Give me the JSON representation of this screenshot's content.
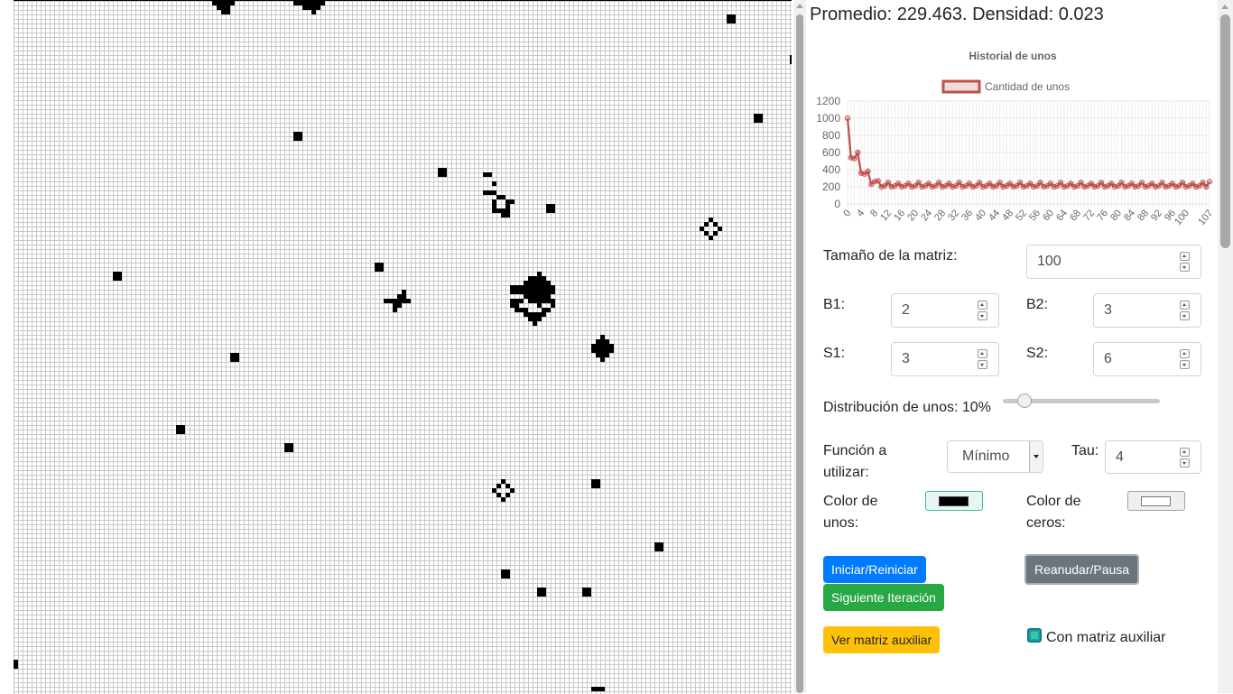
{
  "stats": {
    "text": "Promedio: 229.463. Densidad: 0.023"
  },
  "chart_data": {
    "type": "line",
    "title": "Historial de unos",
    "series": [
      {
        "name": "Cantidad de unos",
        "color": "#c0504d",
        "x": [
          0,
          1,
          2,
          3,
          4,
          5,
          6,
          7,
          8,
          9,
          10,
          11,
          12,
          13,
          14,
          15,
          16,
          17,
          18,
          19,
          20,
          21,
          22,
          23,
          24,
          25,
          26,
          27,
          28,
          29,
          30,
          31,
          32,
          33,
          34,
          35,
          36,
          37,
          38,
          39,
          40,
          41,
          42,
          43,
          44,
          45,
          46,
          47,
          48,
          49,
          50,
          51,
          52,
          53,
          54,
          55,
          56,
          57,
          58,
          59,
          60,
          61,
          62,
          63,
          64,
          65,
          66,
          67,
          68,
          69,
          70,
          71,
          72,
          73,
          74,
          75,
          76,
          77,
          78,
          79,
          80,
          81,
          82,
          83,
          84,
          85,
          86,
          87,
          88,
          89,
          90,
          91,
          92,
          93,
          94,
          95,
          96,
          97,
          98,
          99,
          100,
          101,
          102,
          103,
          104,
          105,
          106,
          107
        ],
        "values": [
          1000,
          540,
          530,
          600,
          360,
          350,
          380,
          230,
          260,
          270,
          200,
          210,
          250,
          200,
          210,
          240,
          200,
          210,
          240,
          200,
          210,
          250,
          200,
          210,
          240,
          200,
          210,
          250,
          200,
          210,
          240,
          200,
          210,
          250,
          200,
          210,
          240,
          200,
          210,
          250,
          200,
          210,
          240,
          200,
          210,
          250,
          200,
          210,
          240,
          200,
          210,
          250,
          200,
          210,
          240,
          200,
          210,
          250,
          200,
          210,
          240,
          200,
          210,
          250,
          200,
          210,
          240,
          200,
          210,
          250,
          200,
          210,
          240,
          200,
          210,
          250,
          200,
          210,
          240,
          200,
          210,
          250,
          200,
          210,
          240,
          200,
          210,
          250,
          200,
          210,
          240,
          200,
          210,
          250,
          200,
          210,
          240,
          200,
          210,
          250,
          200,
          210,
          240,
          200,
          210,
          250,
          200,
          260
        ]
      }
    ],
    "x_ticks": [
      "0",
      "4",
      "8",
      "12",
      "16",
      "20",
      "24",
      "28",
      "32",
      "36",
      "40",
      "44",
      "48",
      "52",
      "56",
      "60",
      "64",
      "68",
      "72",
      "76",
      "80",
      "84",
      "88",
      "92",
      "96",
      "100",
      "107"
    ],
    "y_ticks": [
      "0",
      "200",
      "400",
      "600",
      "800",
      "1000",
      "1200"
    ],
    "ylim": [
      0,
      1200
    ],
    "xlim": [
      0,
      107
    ],
    "grid": true,
    "legend": "top"
  },
  "controls": {
    "size_label": "Tamaño de la matriz:",
    "size_value": "100",
    "b1_label": "B1:",
    "b1_value": "2",
    "b2_label": "B2:",
    "b2_value": "3",
    "s1_label": "S1:",
    "s1_value": "3",
    "s2_label": "S2:",
    "s2_value": "6",
    "dist_label": "Distribución de unos: 10%",
    "dist_value": 10,
    "func_label_1": "Función a",
    "func_label_2": "utilizar:",
    "func_value": "Mínimo",
    "tau_label": "Tau:",
    "tau_value": "4",
    "ones_color_label_1": "Color de",
    "ones_color_label_2": "unos:",
    "ones_color": "#000000",
    "zeros_color_label_1": "Color de",
    "zeros_color_label_2": "ceros:",
    "zeros_color": "#ffffff"
  },
  "buttons": {
    "start": "Iniciar/Reiniciar",
    "pause": "Reanudar/Pausa",
    "next": "Siguiente Iteración",
    "aux": "Ver matriz auxiliar",
    "checkbox_label": "Con matriz auxiliar",
    "checkbox_checked": true
  },
  "colors": {
    "primary": "#007bff",
    "success": "#28a745",
    "secondary": "#6c757d",
    "warning": "#ffc107",
    "line": "#c0504d"
  },
  "grid": {
    "live_cells": [
      [
        44,
        0
      ],
      [
        45,
        0
      ],
      [
        46,
        0
      ],
      [
        47,
        0
      ],
      [
        48,
        0
      ],
      [
        45,
        1
      ],
      [
        46,
        1
      ],
      [
        47,
        1
      ],
      [
        46,
        2
      ],
      [
        47,
        2
      ],
      [
        62,
        0
      ],
      [
        63,
        0
      ],
      [
        64,
        0
      ],
      [
        65,
        0
      ],
      [
        66,
        0
      ],
      [
        67,
        0
      ],
      [
        68,
        0
      ],
      [
        64,
        1
      ],
      [
        65,
        1
      ],
      [
        66,
        1
      ],
      [
        67,
        1
      ],
      [
        66,
        2
      ],
      [
        158,
        3
      ],
      [
        159,
        3
      ],
      [
        158,
        4
      ],
      [
        159,
        4
      ],
      [
        172,
        12
      ],
      [
        172,
        13
      ],
      [
        173,
        13
      ],
      [
        164,
        25
      ],
      [
        165,
        25
      ],
      [
        164,
        26
      ],
      [
        165,
        26
      ],
      [
        62,
        29
      ],
      [
        63,
        29
      ],
      [
        62,
        30
      ],
      [
        63,
        30
      ],
      [
        94,
        37
      ],
      [
        95,
        37
      ],
      [
        94,
        38
      ],
      [
        95,
        38
      ],
      [
        104,
        38
      ],
      [
        105,
        38
      ],
      [
        106,
        40
      ],
      [
        104,
        42
      ],
      [
        105,
        42
      ],
      [
        106,
        42
      ],
      [
        107,
        43
      ],
      [
        108,
        43
      ],
      [
        106,
        44
      ],
      [
        109,
        44
      ],
      [
        110,
        44
      ],
      [
        106,
        45
      ],
      [
        109,
        45
      ],
      [
        106,
        46
      ],
      [
        107,
        46
      ],
      [
        108,
        46
      ],
      [
        109,
        46
      ],
      [
        108,
        47
      ],
      [
        109,
        47
      ],
      [
        118,
        45
      ],
      [
        119,
        45
      ],
      [
        118,
        46
      ],
      [
        119,
        46
      ],
      [
        154,
        48
      ],
      [
        153,
        49
      ],
      [
        155,
        49
      ],
      [
        152,
        50
      ],
      [
        156,
        50
      ],
      [
        153,
        51
      ],
      [
        155,
        51
      ],
      [
        154,
        52
      ],
      [
        80,
        58
      ],
      [
        81,
        58
      ],
      [
        80,
        59
      ],
      [
        81,
        59
      ],
      [
        22,
        60
      ],
      [
        23,
        60
      ],
      [
        22,
        61
      ],
      [
        23,
        61
      ],
      [
        86,
        64
      ],
      [
        85,
        65
      ],
      [
        86,
        65
      ],
      [
        82,
        66
      ],
      [
        83,
        66
      ],
      [
        84,
        66
      ],
      [
        85,
        66
      ],
      [
        86,
        66
      ],
      [
        87,
        66
      ],
      [
        84,
        67
      ],
      [
        85,
        67
      ],
      [
        84,
        68
      ],
      [
        116,
        60
      ],
      [
        114,
        61
      ],
      [
        115,
        61
      ],
      [
        116,
        61
      ],
      [
        117,
        61
      ],
      [
        113,
        62
      ],
      [
        114,
        62
      ],
      [
        115,
        62
      ],
      [
        116,
        62
      ],
      [
        117,
        62
      ],
      [
        118,
        62
      ],
      [
        110,
        63
      ],
      [
        111,
        63
      ],
      [
        112,
        63
      ],
      [
        113,
        63
      ],
      [
        114,
        63
      ],
      [
        115,
        63
      ],
      [
        116,
        63
      ],
      [
        117,
        63
      ],
      [
        118,
        63
      ],
      [
        119,
        63
      ],
      [
        110,
        64
      ],
      [
        111,
        64
      ],
      [
        112,
        64
      ],
      [
        113,
        64
      ],
      [
        114,
        64
      ],
      [
        115,
        64
      ],
      [
        116,
        64
      ],
      [
        117,
        64
      ],
      [
        118,
        64
      ],
      [
        119,
        64
      ],
      [
        113,
        65
      ],
      [
        114,
        65
      ],
      [
        115,
        65
      ],
      [
        116,
        65
      ],
      [
        117,
        65
      ],
      [
        118,
        65
      ],
      [
        114,
        66
      ],
      [
        115,
        66
      ],
      [
        116,
        66
      ],
      [
        117,
        66
      ],
      [
        116,
        67
      ],
      [
        110,
        66
      ],
      [
        111,
        66
      ],
      [
        112,
        66
      ],
      [
        118,
        66
      ],
      [
        119,
        66
      ],
      [
        110,
        67
      ],
      [
        111,
        67
      ],
      [
        119,
        67
      ],
      [
        111,
        68
      ],
      [
        112,
        68
      ],
      [
        113,
        68
      ],
      [
        117,
        68
      ],
      [
        118,
        68
      ],
      [
        113,
        69
      ],
      [
        114,
        69
      ],
      [
        115,
        69
      ],
      [
        116,
        69
      ],
      [
        117,
        69
      ],
      [
        114,
        70
      ],
      [
        115,
        70
      ],
      [
        116,
        70
      ],
      [
        115,
        71
      ],
      [
        130,
        74
      ],
      [
        129,
        75
      ],
      [
        130,
        75
      ],
      [
        131,
        75
      ],
      [
        128,
        76
      ],
      [
        129,
        76
      ],
      [
        130,
        76
      ],
      [
        131,
        76
      ],
      [
        132,
        76
      ],
      [
        128,
        77
      ],
      [
        129,
        77
      ],
      [
        130,
        77
      ],
      [
        131,
        77
      ],
      [
        132,
        77
      ],
      [
        129,
        78
      ],
      [
        130,
        78
      ],
      [
        131,
        78
      ],
      [
        130,
        79
      ],
      [
        48,
        78
      ],
      [
        49,
        78
      ],
      [
        48,
        79
      ],
      [
        49,
        79
      ],
      [
        36,
        94
      ],
      [
        37,
        94
      ],
      [
        36,
        95
      ],
      [
        37,
        95
      ],
      [
        60,
        98
      ],
      [
        61,
        98
      ],
      [
        60,
        99
      ],
      [
        61,
        99
      ],
      [
        108,
        106
      ],
      [
        107,
        107
      ],
      [
        109,
        107
      ],
      [
        106,
        108
      ],
      [
        110,
        108
      ],
      [
        107,
        109
      ],
      [
        109,
        109
      ],
      [
        108,
        110
      ],
      [
        128,
        106
      ],
      [
        129,
        106
      ],
      [
        128,
        107
      ],
      [
        129,
        107
      ],
      [
        142,
        120
      ],
      [
        143,
        120
      ],
      [
        142,
        121
      ],
      [
        143,
        121
      ],
      [
        108,
        126
      ],
      [
        109,
        126
      ],
      [
        108,
        127
      ],
      [
        109,
        127
      ],
      [
        116,
        130
      ],
      [
        117,
        130
      ],
      [
        116,
        131
      ],
      [
        117,
        131
      ],
      [
        126,
        130
      ],
      [
        127,
        130
      ],
      [
        126,
        131
      ],
      [
        127,
        131
      ],
      [
        0,
        146
      ],
      [
        0,
        147
      ],
      [
        128,
        152
      ],
      [
        129,
        152
      ],
      [
        130,
        152
      ]
    ]
  }
}
